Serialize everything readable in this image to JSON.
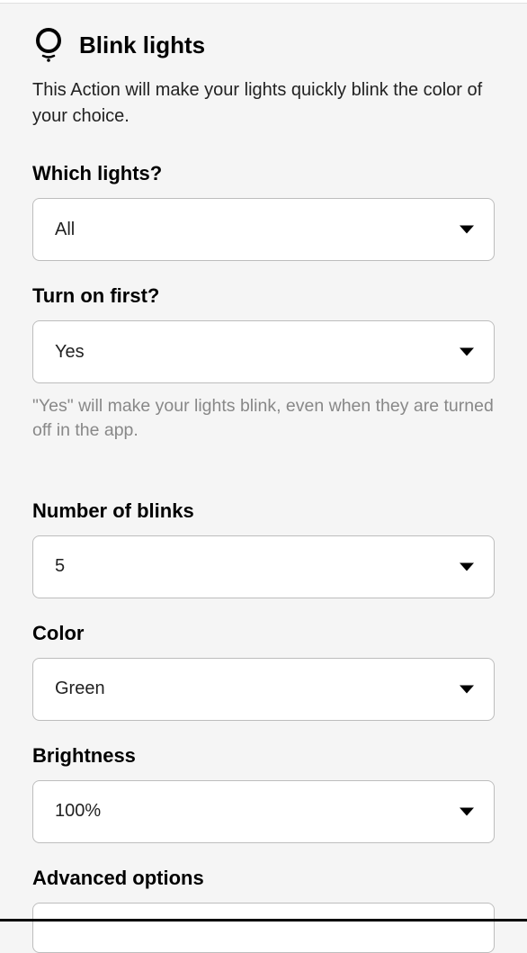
{
  "header": {
    "title": "Blink lights",
    "description": "This Action will make your lights quickly blink the color of your choice."
  },
  "fields": {
    "whichLights": {
      "label": "Which lights?",
      "value": "All"
    },
    "turnOnFirst": {
      "label": "Turn on first?",
      "value": "Yes",
      "hint": "\"Yes\" will make your lights blink, even when they are turned off in the app."
    },
    "numberOfBlinks": {
      "label": "Number of blinks",
      "value": "5"
    },
    "color": {
      "label": "Color",
      "value": "Green"
    },
    "brightness": {
      "label": "Brightness",
      "value": "100%"
    },
    "advancedOptions": {
      "label": "Advanced options",
      "value": ""
    }
  }
}
